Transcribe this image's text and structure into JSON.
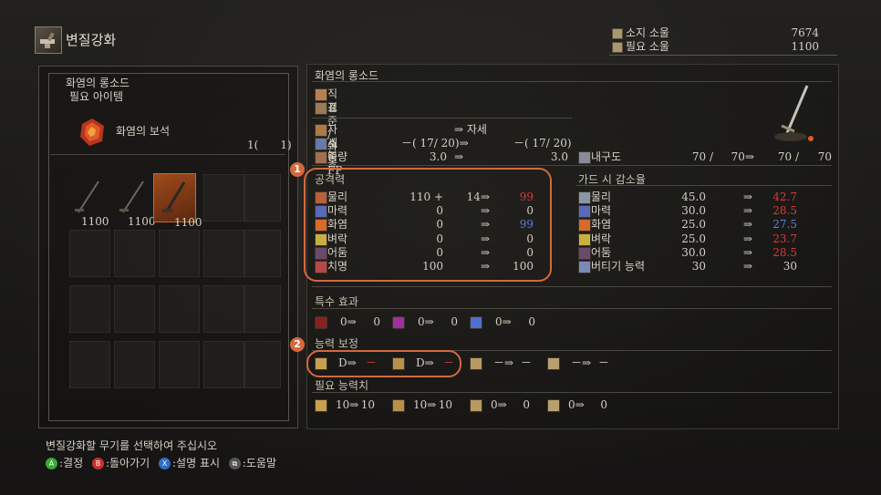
{
  "header": {
    "title": "변질강화",
    "icon": "anvil-icon"
  },
  "souls": {
    "held_label": "소지 소울",
    "held_value": "7674",
    "required_label": "필요 소울",
    "required_value": "1100"
  },
  "left": {
    "weapon_name": "화염의 롱소드",
    "required_items_label": "필요 아이템",
    "gem_name": "화염의 보석",
    "gem_count": "1(　　1)",
    "weapons": [
      {
        "cost": "1100",
        "selected": false
      },
      {
        "cost": "1100",
        "selected": false
      },
      {
        "cost": "1100",
        "selected": true
      }
    ]
  },
  "right": {
    "weapon_name": "화염의 롱소드",
    "type1": "직검",
    "type2": "표준 / 관통",
    "stance": {
      "label": "자세",
      "value": "⇒ 자세"
    },
    "fp": {
      "label": "소비 FP",
      "cur": "－( 17/ 20)⇒",
      "new": "－( 17/ 20)"
    },
    "weight": {
      "label": "중량",
      "cur": "3.0",
      "arrow": "⇒",
      "new": "3.0"
    },
    "durability": {
      "label": "내구도",
      "cur": "70 /",
      "cur2": "70⇒",
      "new": "70 /",
      "new2": "70"
    },
    "attack": {
      "title": "공격력",
      "rows": [
        {
          "label": "물리",
          "cur": "110 +",
          "add": "14⇒",
          "new": "99",
          "new_color": "red"
        },
        {
          "label": "마력",
          "cur": "0",
          "add": "⇒",
          "new": "0",
          "new_color": "normal"
        },
        {
          "label": "화염",
          "cur": "0",
          "add": "⇒",
          "new": "99",
          "new_color": "blue"
        },
        {
          "label": "벼락",
          "cur": "0",
          "add": "⇒",
          "new": "0",
          "new_color": "normal"
        },
        {
          "label": "어둠",
          "cur": "0",
          "add": "⇒",
          "new": "0",
          "new_color": "normal"
        },
        {
          "label": "치명",
          "cur": "100",
          "add": "⇒",
          "new": "100",
          "new_color": "normal"
        }
      ]
    },
    "guard": {
      "title": "가드 시 감소율",
      "rows": [
        {
          "label": "물리",
          "cur": "45.0",
          "arrow": "⇒",
          "new": "42.7",
          "new_color": "red"
        },
        {
          "label": "마력",
          "cur": "30.0",
          "arrow": "⇒",
          "new": "28.5",
          "new_color": "red"
        },
        {
          "label": "화염",
          "cur": "25.0",
          "arrow": "⇒",
          "new": "27.5",
          "new_color": "blue"
        },
        {
          "label": "벼락",
          "cur": "25.0",
          "arrow": "⇒",
          "new": "23.7",
          "new_color": "red"
        },
        {
          "label": "어둠",
          "cur": "30.0",
          "arrow": "⇒",
          "new": "28.5",
          "new_color": "red"
        },
        {
          "label": "버티기 능력",
          "cur": "30",
          "arrow": "⇒",
          "new": "30",
          "new_color": "normal"
        }
      ]
    },
    "special": {
      "title": "특수 효과",
      "items": [
        {
          "icon": "bleed-icon",
          "cur": "0⇒",
          "new": "0"
        },
        {
          "icon": "poison-icon",
          "cur": "0⇒",
          "new": "0"
        },
        {
          "icon": "frost-icon",
          "cur": "0⇒",
          "new": "0"
        }
      ]
    },
    "scaling": {
      "title": "능력 보정",
      "items": [
        {
          "icon": "strength-icon",
          "cur": "D⇒",
          "new": "－"
        },
        {
          "icon": "dexterity-icon",
          "cur": "D⇒",
          "new": "－"
        },
        {
          "icon": "intelligence-icon",
          "cur": "－⇒",
          "new": "－"
        },
        {
          "icon": "faith-icon",
          "cur": "－⇒",
          "new": "－"
        }
      ]
    },
    "requirements": {
      "title": "필요 능력치",
      "items": [
        {
          "icon": "strength-icon",
          "cur": "10⇒",
          "new": "10"
        },
        {
          "icon": "dexterity-icon",
          "cur": "10⇒",
          "new": "10"
        },
        {
          "icon": "intelligence-icon",
          "cur": "0⇒",
          "new": "0"
        },
        {
          "icon": "faith-icon",
          "cur": "0⇒",
          "new": "0"
        }
      ]
    }
  },
  "annotations": [
    "1",
    "2"
  ],
  "footer": {
    "prompt": "변질강화할 무기를 선택하여 주십시오",
    "buttons": [
      {
        "key": "A",
        "color": "#3aa83a",
        "label": ":결정"
      },
      {
        "key": "B",
        "color": "#c83030",
        "label": ":돌아가기"
      },
      {
        "key": "X",
        "color": "#2f6cc8",
        "label": ":설명 표시"
      },
      {
        "key": "⧉",
        "color": "#555555",
        "label": ":도움말"
      }
    ]
  },
  "colors": {
    "red": "#d83a3a",
    "blue": "#5a7fd8",
    "highlight": "#d4683e"
  }
}
